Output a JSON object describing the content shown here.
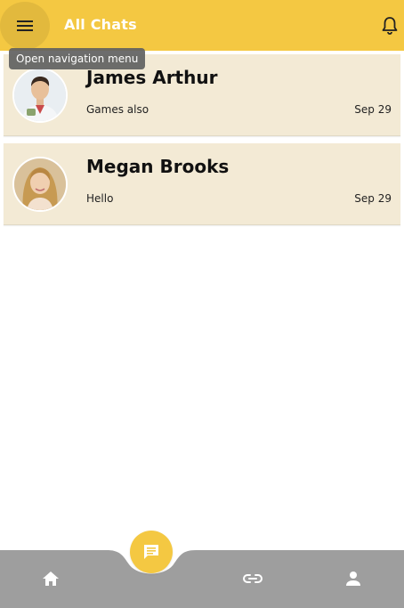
{
  "appbar": {
    "title": "All Chats",
    "menu_icon": "menu-icon",
    "notification_icon": "bell-icon"
  },
  "tooltip": {
    "text": "Open navigation menu"
  },
  "chats": [
    {
      "name": "James Arthur",
      "preview": "Games also",
      "date": "Sep 29",
      "avatar": "avatar-man-photo"
    },
    {
      "name": "Megan Brooks",
      "preview": "Hello",
      "date": "Sep 29",
      "avatar": "avatar-woman-photo"
    }
  ],
  "bottom_nav": {
    "fab_icon": "message-icon",
    "items": [
      "home-icon",
      "link-icon",
      "person-icon"
    ]
  },
  "colors": {
    "accent": "#f4c842",
    "chat_bg": "#f3ead5",
    "nav_bg": "#9e9e9e",
    "tooltip_bg": "#616161"
  }
}
